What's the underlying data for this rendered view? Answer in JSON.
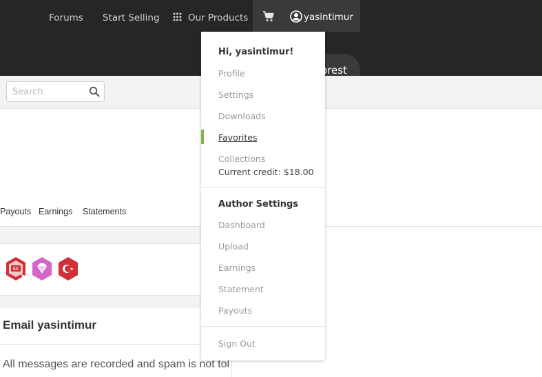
{
  "nav": {
    "forums": "Forums",
    "start_selling": "Start Selling",
    "our_products": "Our Products",
    "username": "yasintimur",
    "grid_icon": "grid-icon",
    "cart_icon": "cart-icon",
    "user_icon": "user-circle-icon"
  },
  "logo": {
    "partial_text": "orest"
  },
  "search": {
    "placeholder": "Search",
    "value": ""
  },
  "tabs": [
    "Payouts",
    "Earnings",
    "Statements"
  ],
  "badges": [
    "sc-badge",
    "gem-badge",
    "turkey-flag-badge"
  ],
  "email": {
    "title": "Email yasintimur",
    "text": "All messages are recorded and spam is not tolerated. Your email address will be shown"
  },
  "dropdown": {
    "greeting": "Hi, yasintimur!",
    "account_items": [
      "Profile",
      "Settings",
      "Downloads",
      "Favorites",
      "Collections"
    ],
    "active_item": "Favorites",
    "credit": "Current credit: $18.00",
    "author_heading": "Author Settings",
    "author_items": [
      "Dashboard",
      "Upload",
      "Earnings",
      "Statement",
      "Payouts"
    ],
    "sign_out": "Sign Out"
  },
  "colors": {
    "topbar": "#262626",
    "active_accent": "#82b541",
    "badge_red": "#d22e36",
    "badge_pink": "#d466c8"
  }
}
